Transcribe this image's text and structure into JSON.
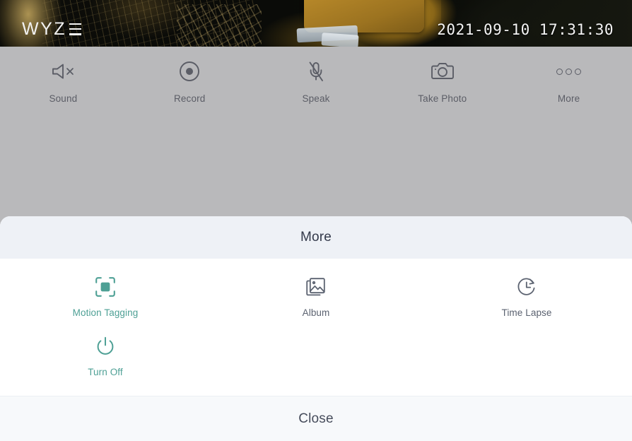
{
  "video": {
    "brand_logo_text": "WYZ",
    "brand_logo_full": "WYZE",
    "timestamp": "2021-09-10 17:31:30"
  },
  "toolbar": {
    "items": [
      {
        "label": "Sound",
        "icon": "speaker-mute-icon"
      },
      {
        "label": "Record",
        "icon": "record-icon"
      },
      {
        "label": "Speak",
        "icon": "microphone-mute-icon"
      },
      {
        "label": "Take Photo",
        "icon": "camera-icon"
      },
      {
        "label": "More",
        "icon": "more-dots-icon"
      }
    ]
  },
  "sheet": {
    "title": "More",
    "close_label": "Close",
    "accent_color": "#4ea095",
    "neutral_color": "#5b6270",
    "items": [
      {
        "label": "Motion Tagging",
        "icon": "motion-tagging-icon",
        "style": "accent"
      },
      {
        "label": "Album",
        "icon": "album-icon",
        "style": "neutral"
      },
      {
        "label": "Time Lapse",
        "icon": "time-lapse-icon",
        "style": "neutral"
      },
      {
        "label": "Turn Off",
        "icon": "power-icon",
        "style": "accent"
      }
    ]
  }
}
